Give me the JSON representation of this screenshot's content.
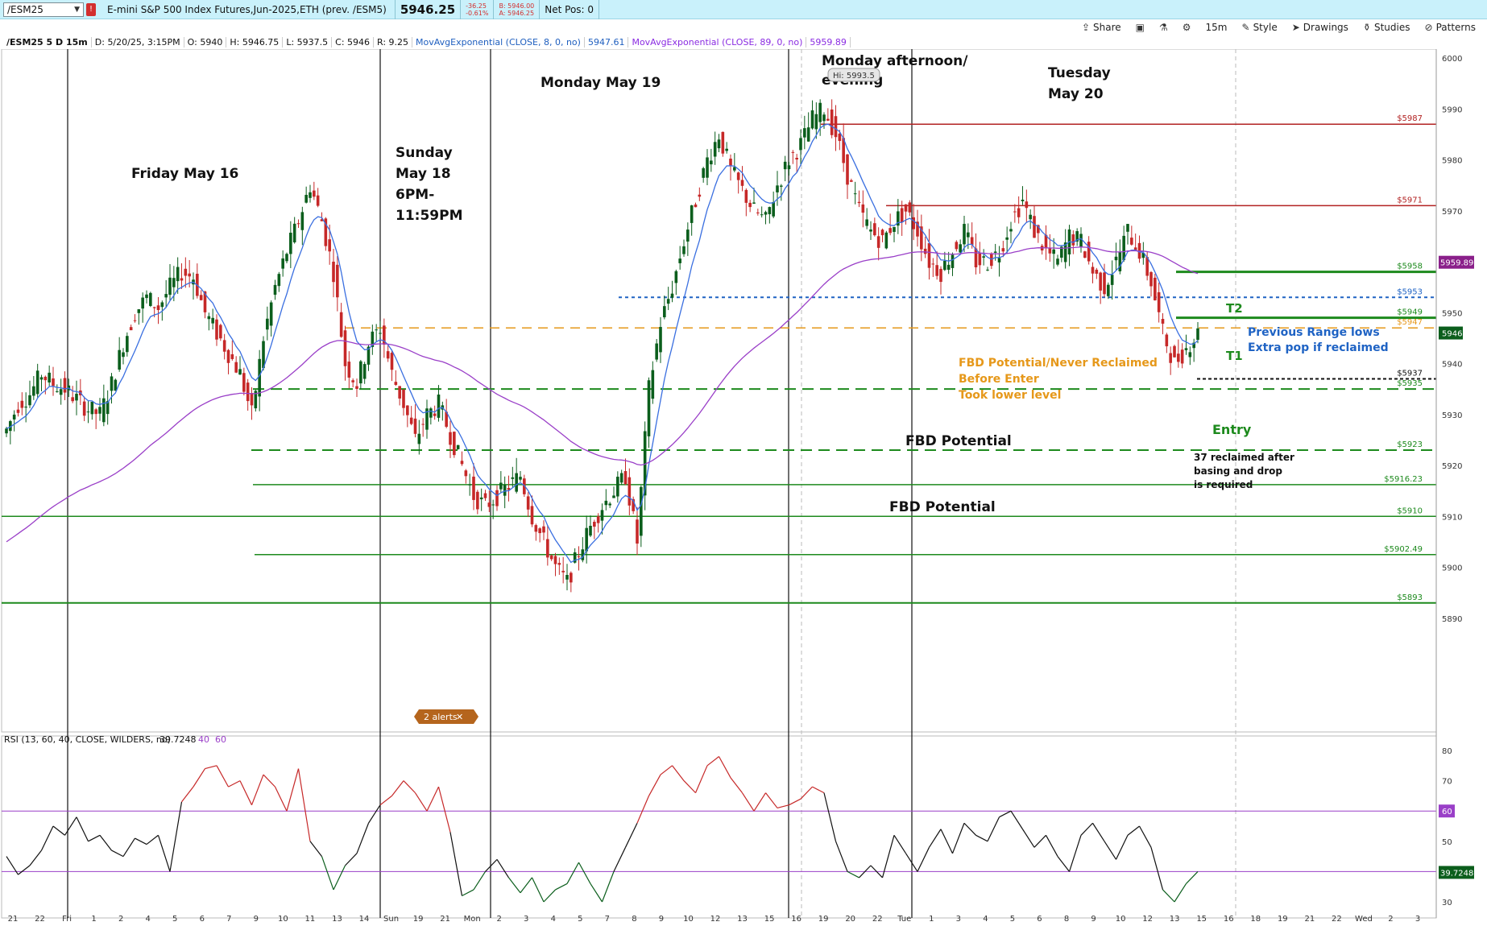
{
  "quotebar": {
    "symbol": "/ESM25",
    "description": "E-mini S&P 500 Index Futures,Jun-2025,ETH (prev. /ESM5)",
    "last": "5946.25",
    "change": "-36.25",
    "change_pct": "-0.61%",
    "bid": "B: 5946.00",
    "ask": "A: 5946.25",
    "netpos": "Net Pos: 0",
    "link_label": "!"
  },
  "toolbar": {
    "share": "Share",
    "timeframe": "15m",
    "style": "Style",
    "drawings": "Drawings",
    "studies": "Studies",
    "patterns": "Patterns"
  },
  "legend": {
    "symbol": "/ESM25 5 D 15m",
    "date": "D: 5/20/25, 3:15PM",
    "open": "O: 5940",
    "high": "H: 5946.75",
    "low": "L: 5937.5",
    "close": "C: 5946",
    "range": "R: 9.25",
    "ema8": "MovAvgExponential (CLOSE, 8, 0, no)",
    "ema8_value": "5947.61",
    "ema89": "MovAvgExponential (CLOSE, 89, 0, no)",
    "ema89_value": "5959.89"
  },
  "rsi_legend": {
    "label": "RSI (13, 60, 40, CLOSE, WILDERS, no)",
    "value": "39.7248",
    "low": "40",
    "high": "60"
  },
  "colors": {
    "up": "#0b5e1c",
    "down": "#c62828",
    "ema8": "#3a6fe0",
    "ema89": "#9a3fc8",
    "green_level": "#1d8a1d",
    "red_level": "#b22222",
    "orange_level": "#e6981a",
    "blue_level": "#1f63c4"
  },
  "price_axis": {
    "ticks": [
      "6000",
      "5990",
      "5980",
      "5970",
      "5960",
      "5950",
      "5940",
      "5930",
      "5920",
      "5910",
      "5900",
      "5890"
    ],
    "current_tag": "5946",
    "ema89_tag": "5959.89"
  },
  "rsi_axis": {
    "ticks": [
      "80",
      "70",
      "60",
      "50",
      "40",
      "30"
    ],
    "tag_60": "60",
    "tag_value": "39.7248"
  },
  "time_axis": [
    "21",
    "22",
    "Fri",
    "1",
    "2",
    "4",
    "5",
    "6",
    "7",
    "9",
    "10",
    "11",
    "13",
    "14",
    "Sun",
    "19",
    "21",
    "Mon",
    "2",
    "3",
    "4",
    "5",
    "7",
    "8",
    "9",
    "10",
    "12",
    "13",
    "15",
    "16",
    "19",
    "20",
    "22",
    "Tue",
    "1",
    "3",
    "4",
    "5",
    "6",
    "8",
    "9",
    "10",
    "12",
    "13",
    "15",
    "16",
    "18",
    "19",
    "21",
    "22",
    "Wed",
    "2",
    "3"
  ],
  "annotations": {
    "friday": "Friday May 16",
    "sunday_1": "Sunday",
    "sunday_2": "May 18",
    "sunday_3": "6PM-",
    "sunday_4": "11:59PM",
    "monday": "Monday May 19",
    "monday_pm_1": "Monday afternoon/",
    "monday_pm_2": "evening",
    "hi_bubble": "Hi: 5993.5",
    "tuesday_1": "Tuesday",
    "tuesday_2": "May 20",
    "t2": "T2",
    "t1": "T1",
    "prev_range_1": "Previous Range lows",
    "prev_range_2": "Extra pop if reclaimed",
    "fbd_never_1": "FBD Potential/Never Reclaimed",
    "fbd_never_2": "Before Enter",
    "fbd_never_3": "Took lower level",
    "entry": "Entry",
    "fbd_potential_1": "FBD Potential",
    "fbd_potential_2": "FBD Potential",
    "note_1": "37 reclaimed after",
    "note_2": "basing and drop",
    "note_3": "is required",
    "alerts": "2 alerts"
  },
  "levels": [
    {
      "label": "$5987",
      "price": 5987,
      "color": "red"
    },
    {
      "label": "$5971",
      "price": 5971,
      "color": "red"
    },
    {
      "label": "$5958",
      "price": 5958,
      "color": "green"
    },
    {
      "label": "$5953",
      "price": 5953,
      "color": "blue"
    },
    {
      "label": "$5949",
      "price": 5949,
      "color": "green"
    },
    {
      "label": "$5947",
      "price": 5947,
      "color": "orange"
    },
    {
      "label": "$5937",
      "price": 5937,
      "color": "black"
    },
    {
      "label": "$5935",
      "price": 5935,
      "color": "green"
    },
    {
      "label": "$5923",
      "price": 5923,
      "color": "green"
    },
    {
      "label": "$5916.23",
      "price": 5916.23,
      "color": "green"
    },
    {
      "label": "$5910",
      "price": 5910,
      "color": "green"
    },
    {
      "label": "$5902.49",
      "price": 5902.49,
      "color": "green"
    },
    {
      "label": "$5893",
      "price": 5893,
      "color": "green"
    }
  ],
  "price_path": [
    5927,
    5932,
    5934,
    5938,
    5936,
    5935,
    5933,
    5931,
    5930,
    5936,
    5944,
    5950,
    5953,
    5951,
    5955,
    5958,
    5957,
    5950,
    5946,
    5942,
    5938,
    5930,
    5945,
    5955,
    5962,
    5968,
    5975,
    5968,
    5958,
    5940,
    5936,
    5944,
    5947,
    5938,
    5932,
    5925,
    5930,
    5932,
    5926,
    5920,
    5914,
    5912,
    5914,
    5916,
    5918,
    5910,
    5905,
    5900,
    5897,
    5903,
    5908,
    5912,
    5915,
    5918,
    5905,
    5935,
    5948,
    5955,
    5964,
    5972,
    5980,
    5985,
    5978,
    5974,
    5970,
    5968,
    5975,
    5980,
    5983,
    5988,
    5990,
    5985,
    5977,
    5970,
    5966,
    5964,
    5968,
    5970,
    5966,
    5960,
    5958,
    5962,
    5966,
    5960,
    5960,
    5962,
    5968,
    5972,
    5966,
    5962,
    5960,
    5965,
    5964,
    5958,
    5955,
    5960,
    5966,
    5962,
    5956,
    5946,
    5940,
    5943,
    5946
  ],
  "rsi_path": [
    45,
    39,
    42,
    47,
    55,
    52,
    58,
    50,
    52,
    47,
    45,
    51,
    49,
    52,
    40,
    63,
    68,
    74,
    75,
    68,
    70,
    62,
    72,
    68,
    60,
    74,
    50,
    45,
    34,
    42,
    46,
    56,
    62,
    65,
    70,
    66,
    60,
    68,
    53,
    32,
    34,
    40,
    44,
    38,
    33,
    38,
    30,
    34,
    36,
    43,
    36,
    30,
    40,
    48,
    56,
    65,
    72,
    75,
    70,
    66,
    75,
    78,
    71,
    66,
    60,
    66,
    61,
    62,
    64,
    68,
    66,
    50,
    40,
    38,
    42,
    38,
    52,
    46,
    40,
    48,
    54,
    46,
    56,
    52,
    50,
    58,
    60,
    54,
    48,
    52,
    45,
    40,
    52,
    56,
    50,
    44,
    52,
    55,
    48,
    34,
    30,
    36,
    40
  ]
}
